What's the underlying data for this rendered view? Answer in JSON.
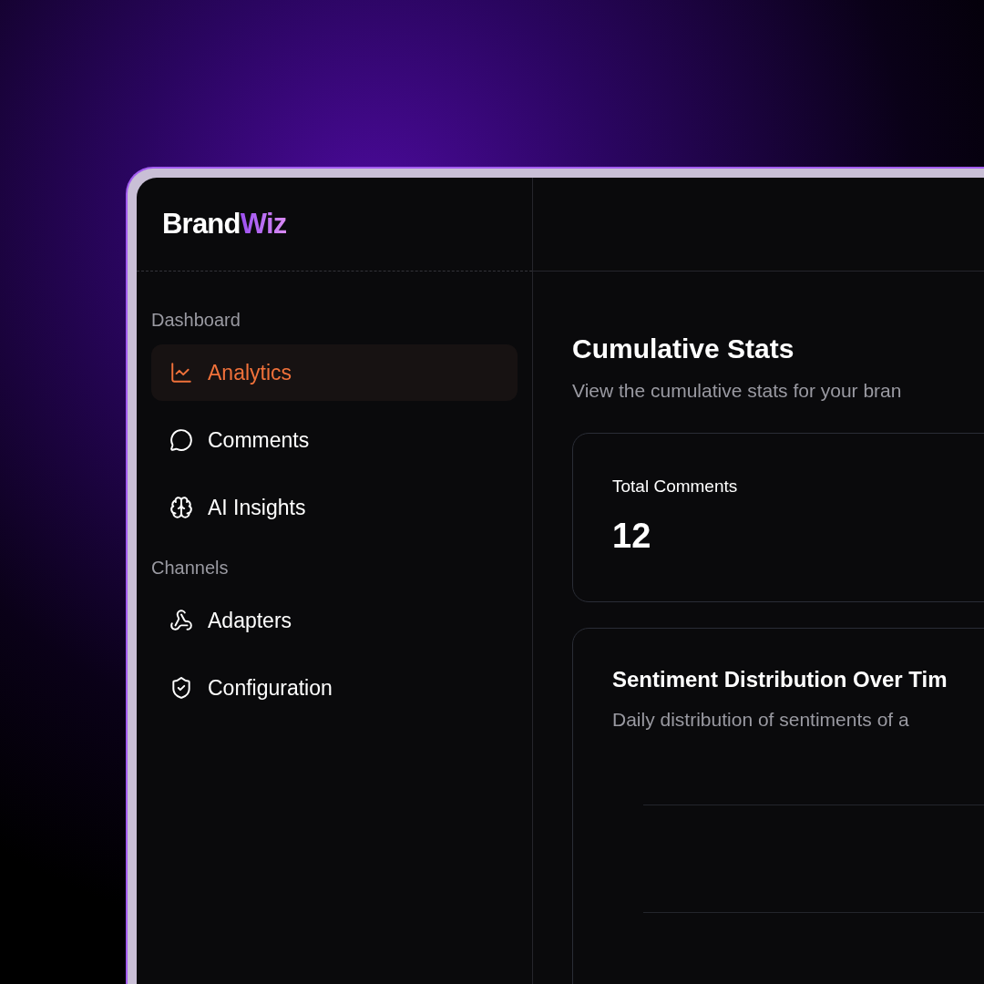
{
  "logo": {
    "first": "Brand",
    "second": "Wiz"
  },
  "sidebar": {
    "sections": [
      {
        "title": "Dashboard",
        "items": [
          {
            "label": "Analytics",
            "selected": true
          },
          {
            "label": "Comments",
            "selected": false
          },
          {
            "label": "AI Insights",
            "selected": false
          }
        ]
      },
      {
        "title": "Channels",
        "items": [
          {
            "label": "Adapters",
            "selected": false
          },
          {
            "label": "Configuration",
            "selected": false
          }
        ]
      }
    ]
  },
  "main": {
    "title": "Cumulative Stats",
    "subtitle": "View the cumulative stats for your bran",
    "stat_card": {
      "label": "Total Comments",
      "value": "12"
    },
    "chart_card": {
      "title": "Sentiment Distribution Over Tim",
      "subtitle": "Daily distribution of sentiments of a"
    }
  }
}
